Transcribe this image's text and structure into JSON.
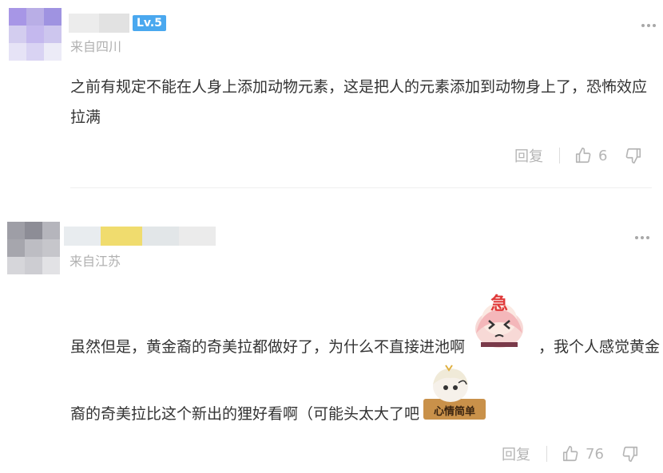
{
  "comments": [
    {
      "level_badge": "Lv.5",
      "location": "来自四川",
      "text": "之前有规定不能在人身上添加动物元素，这是把人的元素添加到动物身上了，恐怖效应拉满",
      "reply_label": "回复",
      "like_count": "6"
    },
    {
      "location": "来自江苏",
      "text_part1": "虽然但是，黄金裔的奇美拉都做好了，为什么不直接进池啊",
      "text_part2": "，我个人感觉黄金",
      "text_part3": "裔的奇美拉比这个新出的狸好看啊（可能头太大了吧",
      "sticker1_text": "急",
      "sticker2_text": "心情简单",
      "reply_label": "回复",
      "like_count": "76"
    }
  ],
  "icons": [
    "more-icon",
    "thumbs-up-icon",
    "thumbs-down-icon"
  ],
  "colors": {
    "badge": "#4aa8ef",
    "muted": "#b5b5b5",
    "text": "#333333"
  }
}
